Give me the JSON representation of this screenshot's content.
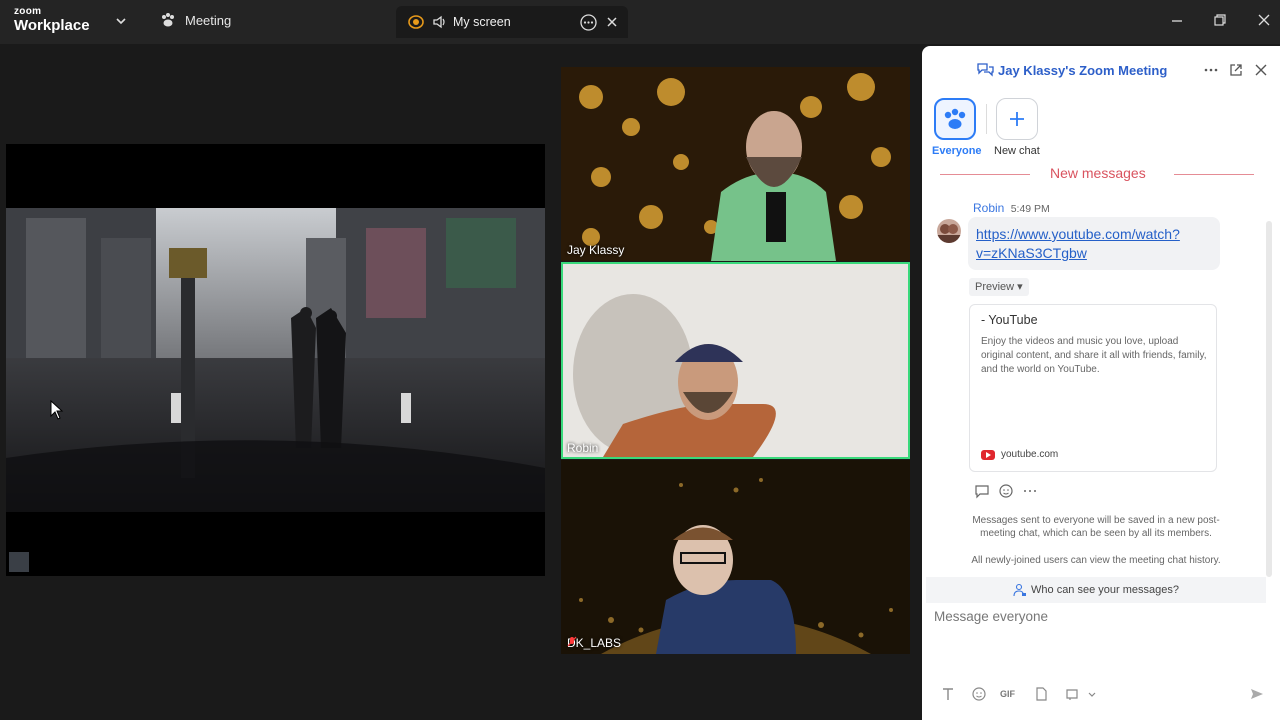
{
  "titlebar": {
    "brand_small": "zoom",
    "brand_big": "Workplace",
    "meeting_tab": "Meeting",
    "screen_tab": "My screen"
  },
  "tiles": [
    {
      "name": "Jay Klassy"
    },
    {
      "name": "Robin"
    },
    {
      "name": "DK_LABS"
    }
  ],
  "chat": {
    "title": "Jay Klassy's Zoom Meeting",
    "tabs": {
      "everyone": "Everyone",
      "new_chat": "New chat"
    },
    "new_messages": "New messages",
    "message": {
      "sender": "Robin",
      "time": "5:49 PM",
      "link_line1": "https://www.youtube.com/watch?",
      "link_line2": "v=zKNaS3CTgbw"
    },
    "preview_label": "Preview ▾",
    "card": {
      "title": "- YouTube",
      "description": "Enjoy the videos and music you love, upload original content, and share it all with friends, family, and the world on YouTube.",
      "site": "youtube.com"
    },
    "notice": "Messages sent to everyone will be saved in a new post-meeting chat, which can be seen by all its members.",
    "notice2": "All newly-joined users can view the meeting chat history.",
    "who_can_see": "Who can see your messages?",
    "composer_placeholder": "Message everyone",
    "gif_label": "GIF"
  },
  "colors": {
    "accent": "#2d7cf6",
    "active_speaker": "#39d97b",
    "new_messages": "#d9535f",
    "link": "#2560c8"
  }
}
